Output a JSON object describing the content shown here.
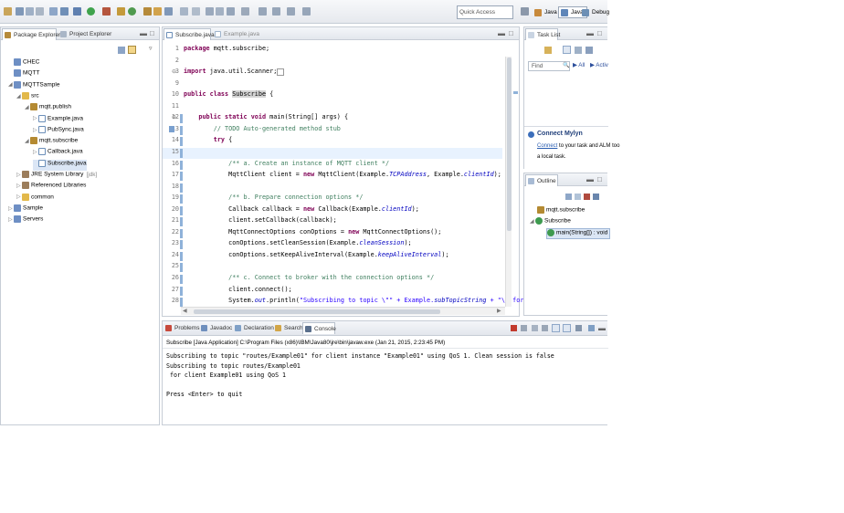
{
  "toolbar": {
    "quick_access_placeholder": "Quick Access",
    "perspectives": [
      "Java EE",
      "Java",
      "Debug"
    ]
  },
  "package_explorer": {
    "tabs": [
      "Package Explorer",
      "Project Explorer"
    ],
    "tree": [
      {
        "label": "CHEC",
        "depth": 0,
        "icon": "project-icon"
      },
      {
        "label": "MQTT",
        "depth": 0,
        "icon": "project-icon"
      },
      {
        "label": "MQTTSample",
        "depth": 0,
        "icon": "project-icon"
      },
      {
        "label": "src",
        "depth": 1,
        "icon": "source-folder-icon"
      },
      {
        "label": "mqtt.publish",
        "depth": 2,
        "icon": "package-icon"
      },
      {
        "label": "Example.java",
        "depth": 3,
        "icon": "java-file-icon"
      },
      {
        "label": "PubSync.java",
        "depth": 3,
        "icon": "java-file-icon"
      },
      {
        "label": "mqtt.subscribe",
        "depth": 2,
        "icon": "package-icon"
      },
      {
        "label": "Callback.java",
        "depth": 3,
        "icon": "java-file-icon"
      },
      {
        "label": "Subscribe.java",
        "depth": 3,
        "icon": "java-file-icon"
      },
      {
        "label": "JRE System Library",
        "suffix": "[jdk]",
        "depth": 1,
        "icon": "library-icon"
      },
      {
        "label": "Referenced Libraries",
        "depth": 1,
        "icon": "library-icon"
      },
      {
        "label": "common",
        "depth": 1,
        "icon": "folder-icon"
      },
      {
        "label": "Sample",
        "depth": 0,
        "icon": "project-icon"
      },
      {
        "label": "Servers",
        "depth": 0,
        "icon": "project-icon"
      }
    ]
  },
  "editor": {
    "tabs": [
      "Subscribe.java",
      "Example.java"
    ],
    "line_numbers": [
      "1",
      "2",
      "3",
      "9",
      "10",
      "11",
      "12",
      "13",
      "14",
      "15",
      "16",
      "17",
      "18",
      "19",
      "20",
      "21",
      "22",
      "23",
      "24",
      "25",
      "26",
      "27",
      "28"
    ]
  },
  "task_list": {
    "tab": "Task List",
    "find_placeholder": "Find",
    "all_label": "All",
    "activate_label": "Activ",
    "mylyn_title": "Connect Mylyn",
    "mylyn_link": "Connect",
    "mylyn_text_1": "to your task and ALM too",
    "mylyn_text_2": "a local task."
  },
  "outline": {
    "tab": "Outline",
    "items": [
      "mqtt.subscribe",
      "Subscribe",
      "main(String[]) : void"
    ]
  },
  "bottom": {
    "tabs": [
      "Problems",
      "Javadoc",
      "Declaration",
      "Search",
      "Console"
    ],
    "console_header": "Subscribe [Java Application] C:\\Program Files (x86)\\IBM\\Java80\\jre\\bin\\javaw.exe (Jan 21, 2015, 2:23:45 PM)",
    "console_lines": [
      "Subscribing to topic \"routes/Example01\" for client instance \"Example01\" using QoS 1. Clean session is false",
      "Subscribing to topic routes/Example01",
      " for client Example01 using QoS 1",
      "",
      "Press <Enter> to quit"
    ]
  }
}
